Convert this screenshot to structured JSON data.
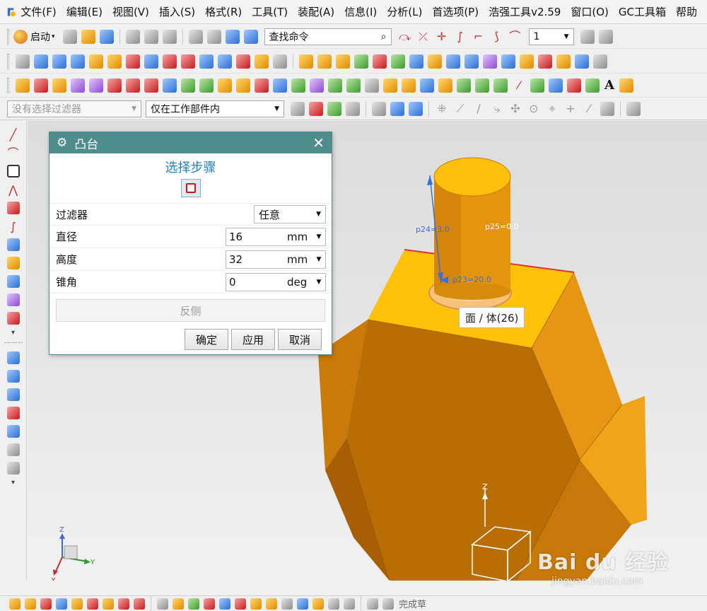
{
  "menubar": {
    "items": [
      "文件(F)",
      "编辑(E)",
      "视图(V)",
      "插入(S)",
      "格式(R)",
      "工具(T)",
      "装配(A)",
      "信息(I)",
      "分析(L)",
      "首选项(P)",
      "浩强工具v2.59",
      "窗口(O)",
      "GC工具箱",
      "帮助"
    ]
  },
  "toolbar1": {
    "start_label": "启动",
    "command_search_value": "查找命令",
    "layer_value": "1"
  },
  "toolbar4": {
    "filter_placeholder": "没有选择过滤器",
    "scope_value": "仅在工作部件内"
  },
  "dialog": {
    "title": "凸台",
    "step_title": "选择步骤",
    "filter_label": "过滤器",
    "filter_value": "任意",
    "diameter_label": "直径",
    "diameter_value": "16",
    "diameter_unit": "mm",
    "height_label": "高度",
    "height_value": "32",
    "height_unit": "mm",
    "taper_label": "锥角",
    "taper_value": "0",
    "taper_unit": "deg",
    "reverse_label": "反侧",
    "ok_label": "确定",
    "apply_label": "应用",
    "cancel_label": "取消"
  },
  "viewport": {
    "dim_p24": "p24=3.0",
    "dim_p25": "p25=0.0",
    "dim_p23": "p23=20.0",
    "tooltip": "面 / 体(26)",
    "axis_z": "Z",
    "axis_y": "Y",
    "axis_x": "X"
  },
  "watermark": {
    "brand": "Bai du 经验",
    "url": "jingyan.baidu.com"
  },
  "bottombar": {
    "done_label": "完成草"
  },
  "colors": {
    "dialog_title_bg": "#4f8c8c",
    "model_orange": "#f0a010",
    "model_top": "#ffc107",
    "dim_blue": "#3a6fd8",
    "step_title_blue": "#1e7fbf"
  }
}
